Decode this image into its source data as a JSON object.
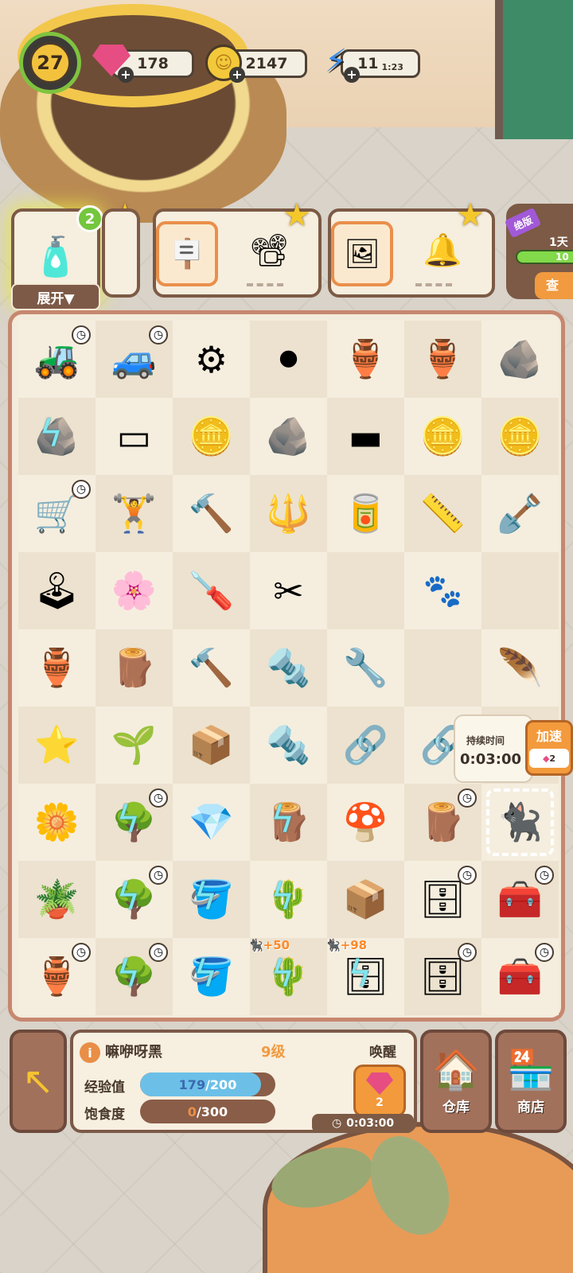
{
  "player": {
    "level": "27",
    "gems": "178",
    "coins": "2147",
    "energy": "11",
    "energy_timer": "1:23"
  },
  "orders": {
    "expand_label": "展开▼",
    "spray_count": "2",
    "event": {
      "tag": "绝版",
      "days": "1天",
      "progress_text": "10",
      "button_label": "查"
    }
  },
  "board": {
    "columns": 7,
    "rows": [
      [
        {
          "icon": "🚜",
          "name": "mine-cart-toy",
          "timer": true
        },
        {
          "icon": "🚙",
          "name": "white-cart-toy",
          "timer": true
        },
        {
          "icon": "⚙",
          "name": "tire-stack"
        },
        {
          "icon": "⚫",
          "name": "tire"
        },
        {
          "icon": "🏺",
          "name": "broken-pot"
        },
        {
          "icon": "🏺",
          "name": "broken-pot-shard"
        },
        {
          "icon": "🪨",
          "name": "pot-fragments"
        }
      ],
      [
        {
          "icon": "🪨",
          "name": "gold-ore-block",
          "locked": true
        },
        {
          "icon": "▭",
          "name": "glass-pane"
        },
        {
          "icon": "🪙",
          "name": "gold-nuggets"
        },
        {
          "icon": "🪨",
          "name": "ore-rock"
        },
        {
          "icon": "▬",
          "name": "metal-plates"
        },
        {
          "icon": "🪙",
          "name": "coins-small"
        },
        {
          "icon": "🪙",
          "name": "coins-pile"
        }
      ],
      [
        {
          "icon": "🛒",
          "name": "mine-cart",
          "timer": true
        },
        {
          "icon": "🏋",
          "name": "dumbbells"
        },
        {
          "icon": "🔨",
          "name": "mallet"
        },
        {
          "icon": "🔱",
          "name": "garden-fork"
        },
        {
          "icon": "🥫",
          "name": "paint-can"
        },
        {
          "icon": "📏",
          "name": "tape-measure"
        },
        {
          "icon": "🪏",
          "name": "trowel"
        }
      ],
      [
        {
          "icon": "🕹",
          "name": "arcade-machine"
        },
        {
          "icon": "🌸",
          "name": "flower-pot"
        },
        {
          "icon": "🪛",
          "name": "screwdriver"
        },
        {
          "icon": "✂",
          "name": "pliers"
        },
        {
          "empty": true
        },
        {
          "empty": true,
          "paw": true
        },
        {
          "empty": true
        }
      ],
      [
        {
          "icon": "🏺",
          "name": "vase-plant"
        },
        {
          "icon": "🪵",
          "name": "wooden-pallet"
        },
        {
          "icon": "🔨",
          "name": "hammer"
        },
        {
          "icon": "🔩",
          "name": "screws"
        },
        {
          "icon": "🔧",
          "name": "syringe-tools"
        },
        {
          "empty": true
        },
        {
          "icon": "🪶",
          "name": "feather-duster"
        }
      ],
      [
        {
          "icon": "⭐",
          "name": "star-sticker"
        },
        {
          "icon": "🌱",
          "name": "sapling"
        },
        {
          "icon": "📦",
          "name": "bundled-sacks"
        },
        {
          "icon": "🔩",
          "name": "bolt-and-nut"
        },
        {
          "icon": "🔗",
          "name": "door-handle"
        },
        {
          "icon": "🔗",
          "name": "handle-pair"
        },
        {
          "empty": true
        }
      ],
      [
        {
          "icon": "🌼",
          "name": "blue-flower"
        },
        {
          "icon": "🌳",
          "name": "bonsai-tree",
          "timer": true,
          "locked": true
        },
        {
          "icon": "💎",
          "name": "pink-gems"
        },
        {
          "icon": "🪵",
          "name": "wood-planks",
          "locked": true
        },
        {
          "icon": "🍄",
          "name": "mushrooms"
        },
        {
          "icon": "🪵",
          "name": "lumber-pile",
          "timer": true
        },
        {
          "icon": "🐈‍⬛",
          "name": "sleeping-black-cat",
          "selected": true
        }
      ],
      [
        {
          "icon": "🪴",
          "name": "blue-flower-planter"
        },
        {
          "icon": "🌳",
          "name": "fruit-tree",
          "timer": true,
          "locked": true
        },
        {
          "icon": "🪣",
          "name": "glass-bucket",
          "locked": true
        },
        {
          "icon": "🌵",
          "name": "cactus-pot",
          "locked": true
        },
        {
          "icon": "📦",
          "name": "wooden-box"
        },
        {
          "icon": "🗄",
          "name": "wood-cabinet",
          "timer": true
        },
        {
          "icon": "🧰",
          "name": "toolbox",
          "timer": true
        }
      ],
      [
        {
          "icon": "🏺",
          "name": "decorated-vase",
          "timer": true
        },
        {
          "icon": "🌳",
          "name": "fruit-tree-large",
          "timer": true,
          "locked": true
        },
        {
          "icon": "🪣",
          "name": "glass-bucket-large",
          "locked": true
        },
        {
          "icon": "🌵",
          "name": "cactus-planter",
          "locked": true,
          "bonus": "🐈‍⬛+50"
        },
        {
          "icon": "🗄",
          "name": "mint-cabinet",
          "locked": true,
          "bonus": "🐈‍⬛+98"
        },
        {
          "icon": "🗄",
          "name": "wooden-dresser",
          "timer": true
        },
        {
          "icon": "🧰",
          "name": "open-toolbox",
          "timer": true
        }
      ]
    ]
  },
  "tooltip": {
    "label": "持续时间",
    "time": "0:03:00",
    "speed_label": "加速",
    "speed_cost": "2"
  },
  "pet": {
    "name": "嘛咿呀黑",
    "level": "9级",
    "wake_label": "唤醒",
    "exp_label": "经验值",
    "exp_current": "179",
    "exp_max": "/200",
    "exp_fraction": 0.895,
    "hunger_label": "饱食度",
    "hunger_current": "0",
    "hunger_max": "/300",
    "hunger_fraction": 0,
    "wake_cost": "2",
    "wake_timer": "0:03:00"
  },
  "nav": {
    "storage_label": "仓库",
    "shop_label": "商店"
  }
}
